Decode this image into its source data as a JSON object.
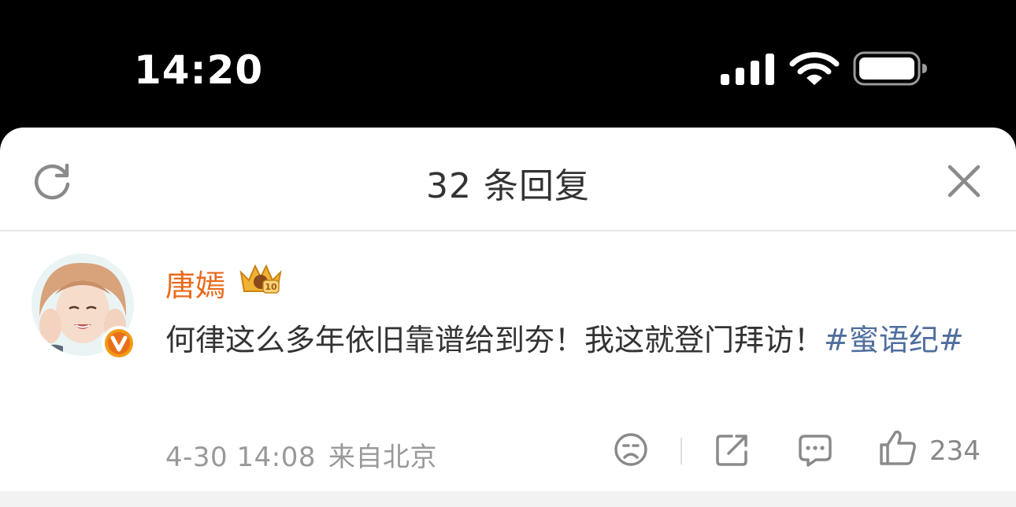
{
  "status_bar": {
    "time": "14:20",
    "icons": [
      "cellular-signal-icon",
      "wifi-icon",
      "battery-icon"
    ]
  },
  "sheet": {
    "title": "32 条回复",
    "left_icon": "refresh-icon",
    "right_icon": "close-icon"
  },
  "comment": {
    "username": "唐嫣",
    "username_color": "#e96a1c",
    "badge_icon": "crown-badge-icon",
    "text": "何律这么多年依旧靠谱给到夯！我这就登门拜访！",
    "hashtag": "#蜜语纪#",
    "hashtag_color": "#4f6e9e",
    "date": "4-30 14:08",
    "source": "来自北京",
    "actions": {
      "dislike_icon": "sad-face-icon",
      "share_icon": "share-icon",
      "comment_icon": "comment-bubble-icon",
      "like_icon": "thumbs-up-icon",
      "like_count": "234"
    }
  }
}
